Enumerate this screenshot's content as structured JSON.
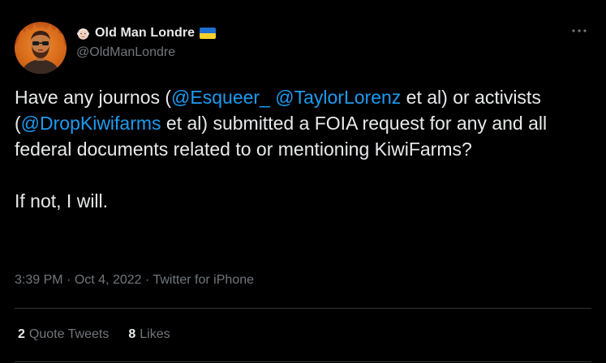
{
  "author": {
    "display_name": "Old Man Londre",
    "handle": "@OldManLondre",
    "name_emoji_icon": "older-man-face-icon",
    "flag_icon": "ukraine-flag-icon",
    "flag_colors": {
      "top": "#1f6fd1",
      "bottom": "#f7d02c"
    },
    "avatar_icon": "avatar-bearded-man-fire"
  },
  "tweet": {
    "paragraph1": [
      {
        "text": "Have any journos (",
        "type": "text"
      },
      {
        "text": "@Esqueer_",
        "type": "mention"
      },
      {
        "text": " ",
        "type": "text"
      },
      {
        "text": "@TaylorLorenz",
        "type": "mention"
      },
      {
        "text": " et al) or activists (",
        "type": "text"
      },
      {
        "text": "@DropKiwifarms",
        "type": "mention"
      },
      {
        "text": " et al) submitted a FOIA request for any and all federal documents related to or mentioning KiwiFarms?",
        "type": "text"
      }
    ],
    "paragraph2": "If not, I will."
  },
  "meta": {
    "time": "3:39 PM",
    "date": "Oct 4, 2022",
    "source": "Twitter for iPhone",
    "separator": "·"
  },
  "stats": {
    "quote_tweets_count": "2",
    "quote_tweets_label": "Quote Tweets",
    "likes_count": "8",
    "likes_label": "Likes"
  },
  "colors": {
    "background": "#000000",
    "text": "#e7e9ea",
    "muted": "#71767b",
    "link": "#1d9bf0",
    "divider": "#2f3336"
  }
}
